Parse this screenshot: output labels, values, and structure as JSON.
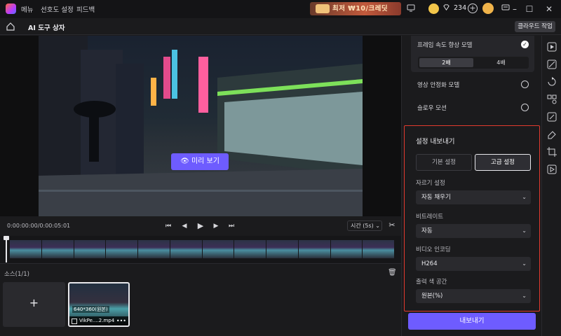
{
  "titlebar": {
    "menu": [
      "메뉴",
      "선호도 설정",
      "피드백"
    ],
    "promo": "최저 ₩10/크레딧",
    "credits": "234"
  },
  "toolbar2": {
    "title": "AI 도구 상자",
    "cloud_button": "클라우드 작업"
  },
  "preview": {
    "button_label": "미리 보기"
  },
  "timeline": {
    "timecode": "0:00:00:00/0:00:05:01",
    "time_select": "시간 (5s)"
  },
  "sources": {
    "label": "소스(1/1)",
    "add_symbol": "+",
    "clip": {
      "resolution": "640*360(원본)",
      "name": "VikPe....2.mp4"
    }
  },
  "panel": {
    "frame_model": "프레임 속도 향상 모델",
    "frame_options": [
      "2배",
      "4배"
    ],
    "stabilize_model": "영상 안정화 모델",
    "slow_motion": "슬로우 모션",
    "export": {
      "title": "설정 내보내기",
      "basic": "기본 설정",
      "advanced": "고급 설정",
      "fields": [
        {
          "label": "자르기 설정",
          "value": "자동 채우기"
        },
        {
          "label": "비트레이트",
          "value": "자동"
        },
        {
          "label": "비디오 인코딩",
          "value": "H264"
        },
        {
          "label": "출력 색 공간",
          "value": "원본(%)"
        }
      ]
    },
    "export_button": "내보내기"
  },
  "colors": {
    "accent": "#6e5cff",
    "highlight_border": "#e23a2e"
  },
  "icons": [
    "app-logo-icon",
    "gift-icon",
    "monitor-icon",
    "chat-icon",
    "coin-icon",
    "diamond-icon",
    "plus-icon",
    "avatar-icon",
    "minimize-icon",
    "maximize-icon",
    "close-icon",
    "home-icon",
    "eye-icon",
    "skip-back-icon",
    "step-back-icon",
    "play-icon",
    "step-forward-icon",
    "skip-forward-icon",
    "scissors-icon",
    "trash-icon",
    "video-enhance-icon",
    "magic-icon",
    "rotate-icon",
    "shapes-icon",
    "edit-icon",
    "eraser-icon",
    "crop-icon",
    "video-ai-icon"
  ]
}
